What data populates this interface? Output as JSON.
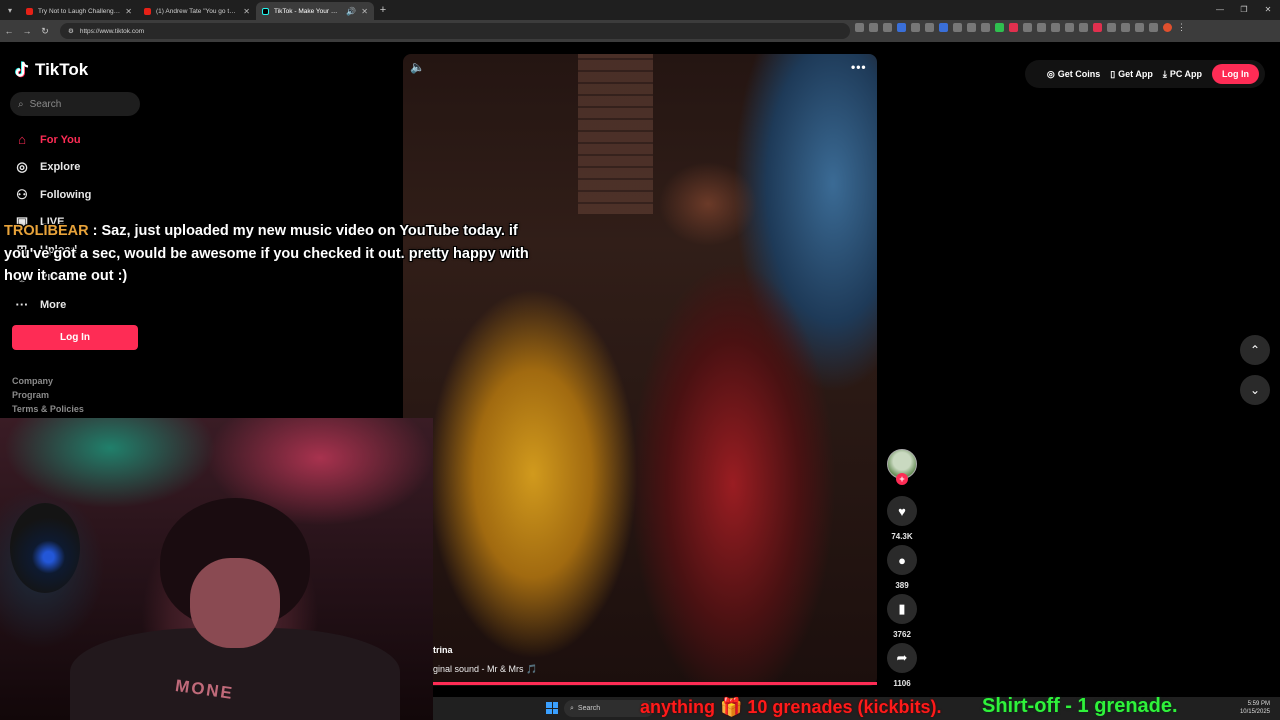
{
  "browser": {
    "tabs": [
      {
        "title": "Try Not to Laugh Challenge 141",
        "active": false
      },
      {
        "title": "(1) Andrew Tate \"You go to you",
        "active": false
      },
      {
        "title": "TikTok - Make Your Day",
        "active": true
      }
    ],
    "url": "https://www.tiktok.com"
  },
  "tiktok": {
    "logo_text": "TikTok",
    "search_placeholder": "Search",
    "nav": [
      {
        "label": "For You",
        "icon": "home-icon",
        "active": true
      },
      {
        "label": "Explore",
        "icon": "compass-icon",
        "active": false
      },
      {
        "label": "Following",
        "icon": "user-follow-icon",
        "active": false
      },
      {
        "label": "LIVE",
        "icon": "live-icon",
        "active": false
      },
      {
        "label": "Upload",
        "icon": "upload-icon",
        "active": false
      },
      {
        "label": "Profile",
        "icon": "profile-icon",
        "active": false
      },
      {
        "label": "More",
        "icon": "more-icon",
        "active": false
      }
    ],
    "login_label": "Log In",
    "footer_links": [
      "Company",
      "Program",
      "Terms & Policies"
    ],
    "top_actions": {
      "get_coins": "Get Coins",
      "get_app": "Get App",
      "pc_app": "PC App",
      "login": "Log In"
    },
    "video": {
      "username": "trina",
      "sound": "ginal sound - Mr & Mrs 🎵",
      "likes": "74.3K",
      "comments": "389",
      "saves": "3762",
      "shares": "1106"
    }
  },
  "stream_overlay": {
    "chat_user": "TROLIBEAR",
    "chat_message": " : Saz, just uploaded my new music video on YouTube today. if you've got a sec, would be awesome if you checked it out. pretty happy with how it came out :)",
    "ticker_red": "anything 🎁 10 grenades (kickbits).",
    "ticker_green": "Shirt-off -   1 grenade.",
    "webcam_shirt_text": "MONE"
  },
  "taskbar": {
    "search_label": "Search",
    "time": "5:59 PM",
    "date": "10/15/2025"
  },
  "colors": {
    "accent": "#fe2c55",
    "chat_user": "#e8a33a",
    "ticker_red": "#ff1a1a",
    "ticker_green": "#2ff23a"
  }
}
